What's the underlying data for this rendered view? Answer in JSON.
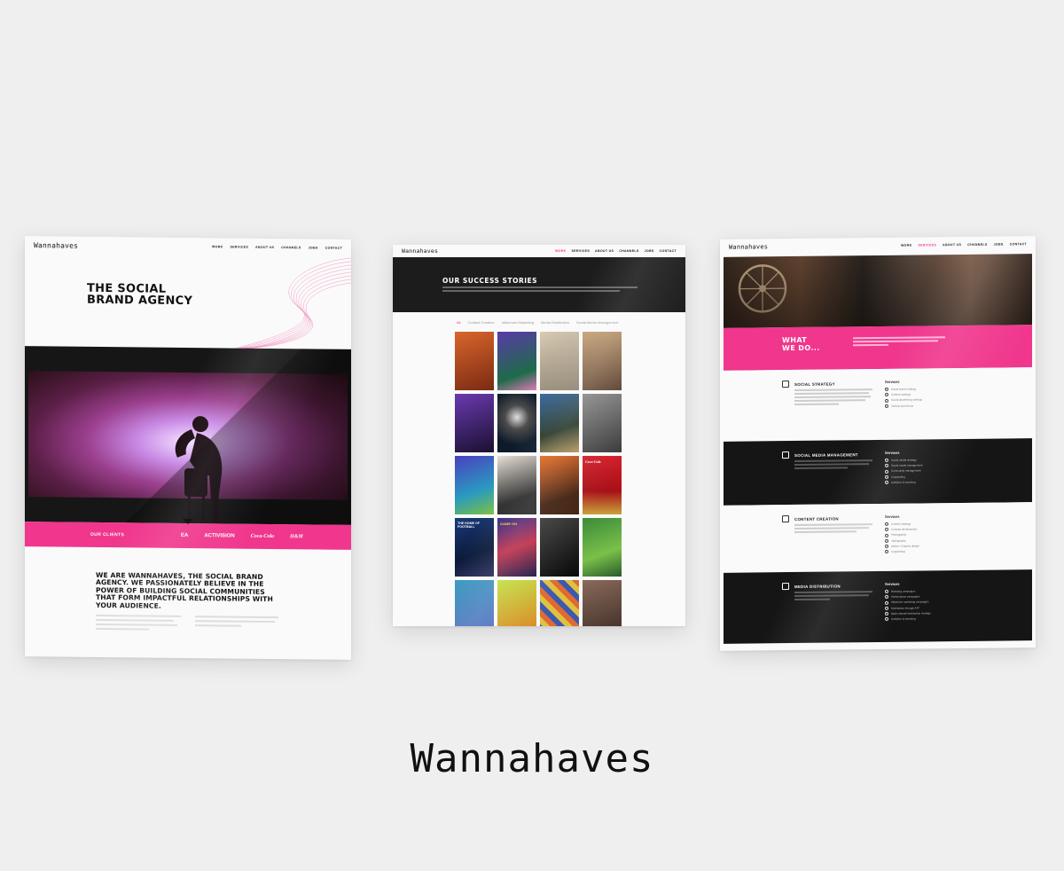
{
  "brand": {
    "wordmark": "Wannahaves"
  },
  "nav": {
    "logo": "Wannahaves",
    "links": [
      "WORK",
      "SERVICES",
      "ABOUT US",
      "CHANNELS",
      "JOBS",
      "CONTACT"
    ]
  },
  "home": {
    "hero_title_line1": "THE SOCIAL",
    "hero_title_line2": "BRAND AGENCY",
    "clients_label": "OUR CLIENTS",
    "client_logos": [
      "EA",
      "ACTIVISION",
      "Coca-Cola",
      "H&M"
    ],
    "about_headline": "WE ARE WANNAHAVES, THE SOCIAL BRAND AGENCY. WE PASSIONATELY BELIEVE IN THE POWER OF BUILDING SOCIAL COMMUNITIES THAT FORM IMPACTFUL RELATIONSHIPS WITH YOUR AUDIENCE."
  },
  "work": {
    "banner_title": "OUR SUCCESS STORIES",
    "filters": [
      "All",
      "Content Creation",
      "Influencer Marketing",
      "Media Distribution",
      "Social Media Management"
    ],
    "tile_labels": [
      "THE HOME OF FOOTBALL",
      "GAME ON",
      "Coca-Cola"
    ]
  },
  "services": {
    "what_title_line1": "WHAT",
    "what_title_line2": "WE DO...",
    "blocks": [
      {
        "title": "SOCIAL STRATEGY",
        "head": "Services",
        "theme": "light",
        "items": [
          "Social brand strategy",
          "Content strategy",
          "Social advertising strategy",
          "Tactical brand tone"
        ]
      },
      {
        "title": "SOCIAL MEDIA MANAGEMENT",
        "head": "Services",
        "theme": "dark",
        "items": [
          "Social media strategy",
          "Social media management",
          "Community management",
          "Copywriting",
          "Analytics & reporting"
        ]
      },
      {
        "title": "CONTENT CREATION",
        "head": "Services",
        "theme": "light",
        "items": [
          "Content strategy",
          "Concept development",
          "Photography",
          "Videography",
          "Motion / Graphic design",
          "Copywriting"
        ]
      },
      {
        "title": "MEDIA DISTRIBUTION",
        "head": "Services",
        "theme": "dark",
        "items": [
          "Branding campaigns",
          "Performance campaigns",
          "Influencer marketing campaigns",
          "Distribution through ATF",
          "Multi-channel distribution strategy",
          "Analytics & reporting"
        ]
      }
    ]
  },
  "colors": {
    "accent": "#f0368d",
    "dark": "#151515",
    "background": "#efefef"
  }
}
